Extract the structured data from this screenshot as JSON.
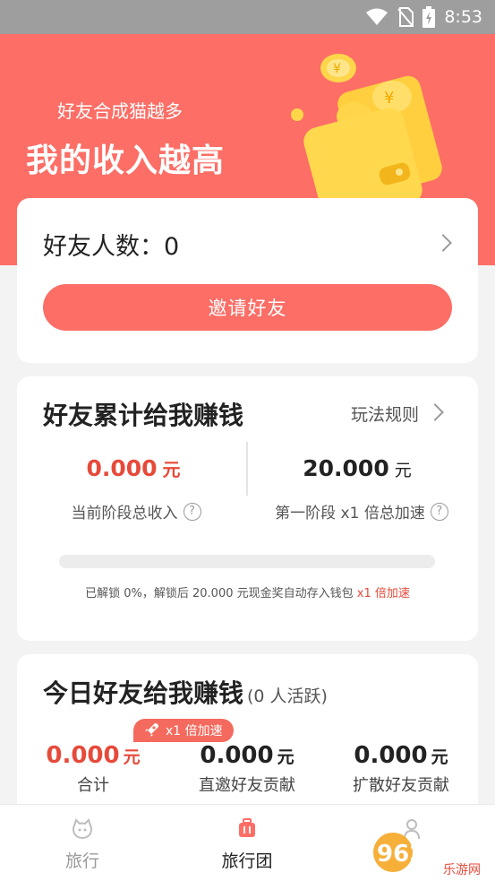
{
  "status_bar": {
    "time": "8:53",
    "icons": [
      "wifi-icon",
      "no-sim-icon",
      "battery-charging-icon"
    ]
  },
  "hero": {
    "subtitle": "好友合成猫越多",
    "title": "我的收入越高",
    "illustration": "wallet-coins-illustration"
  },
  "friends_card": {
    "count_label": "好友人数：0",
    "invite_button": "邀请好友"
  },
  "cumulative_card": {
    "title": "好友累计给我赚钱",
    "rules_link": "玩法规则",
    "current_income_value": "0.000",
    "current_income_unit": "元",
    "current_income_label": "当前阶段总收入",
    "target_value": "20.000",
    "target_unit": "元",
    "stage_label": "第一阶段 x1 倍总加速",
    "progress_percent": 0,
    "unlock_note_main": "已解锁 0%，解锁后 20.000 元现金奖自动存入钱包",
    "unlock_note_accent": "x1 倍加速"
  },
  "today_card": {
    "title": "今日好友给我赚钱",
    "active_note": "(0 人活跃)",
    "badge": "x1 倍加速",
    "stats": [
      {
        "value": "0.000",
        "unit": "元",
        "label": "合计"
      },
      {
        "value": "0.000",
        "unit": "元",
        "label": "直邀好友贡献"
      },
      {
        "value": "0.000",
        "unit": "元",
        "label": "扩散好友贡献"
      }
    ]
  },
  "bottom_nav": {
    "items": [
      {
        "label": "旅行",
        "icon": "cat-face-icon"
      },
      {
        "label": "旅行团",
        "icon": "luggage-icon"
      },
      {
        "label": "",
        "icon": "profile-icon"
      }
    ]
  },
  "watermark": {
    "brand": "962.NET",
    "sub": "乐游网"
  },
  "colors": {
    "accent": "#fc6e66",
    "money_red": "#e64a3a",
    "background": "#f3f3f3"
  }
}
